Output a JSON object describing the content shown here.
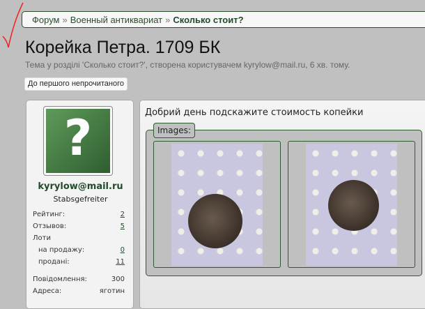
{
  "breadcrumb": {
    "items": [
      "Форум",
      "Военный антиквариат"
    ],
    "separator": "»",
    "current": "Сколько стоит?"
  },
  "thread": {
    "title": "Корейка Петра. 1709 БК",
    "subtitle": "Тема у розділі 'Сколько стоит?', створена користувачем kyrylow@mail.ru, 6 хв. тому.",
    "first_unread_button": "До першого непрочитаного"
  },
  "user": {
    "avatar_icon": "question-mark-icon",
    "name": "kyrylow@mail.ru",
    "rank": "Stabsgefreiter",
    "stats": [
      {
        "label": "Рейтинг:",
        "value": "2"
      },
      {
        "label": "Отзывов:",
        "value": "5"
      },
      {
        "label": "Лоти",
        "value": ""
      },
      {
        "label": "на продажу:",
        "value": "0"
      },
      {
        "label": "продані:",
        "value": "11"
      },
      {
        "label": "Повідомлення:",
        "value": "300"
      },
      {
        "label": "Адреса:",
        "value": "яготин"
      }
    ]
  },
  "post": {
    "message": "Добрий день подскажите стоимость копейки",
    "images_legend": "Images:"
  }
}
